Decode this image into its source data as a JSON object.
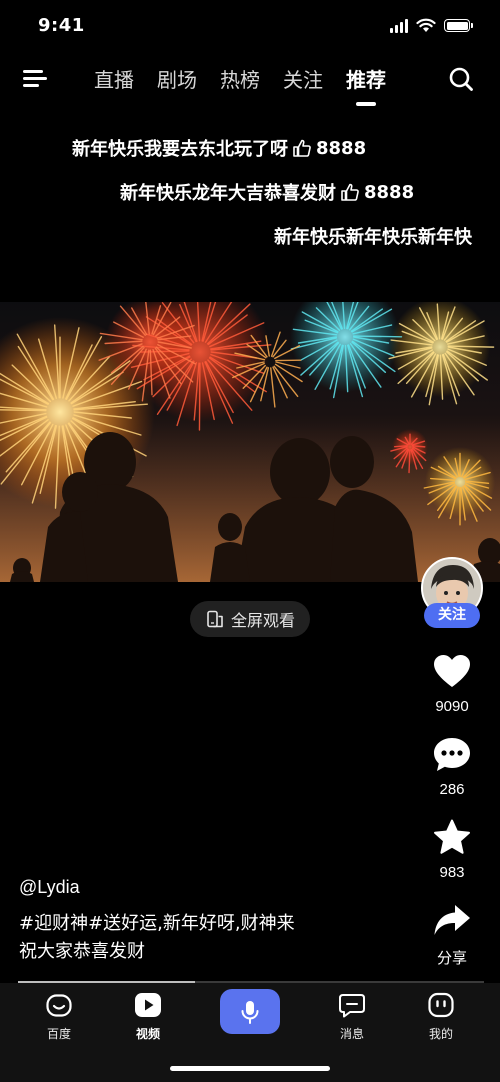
{
  "status_bar": {
    "time": "9:41"
  },
  "top_nav": {
    "tabs": [
      {
        "label": "直播",
        "active": false
      },
      {
        "label": "剧场",
        "active": false
      },
      {
        "label": "热榜",
        "active": false
      },
      {
        "label": "关注",
        "active": false
      },
      {
        "label": "推荐",
        "active": true
      }
    ]
  },
  "danmaku": [
    {
      "text": "新年快乐我要去东北玩了呀",
      "likes": "8888"
    },
    {
      "text": "新年快乐龙年大吉恭喜发财",
      "likes": "8888"
    },
    {
      "text": "新年快乐新年快乐新年快"
    }
  ],
  "video": {
    "fullscreen_label": "全屏观看",
    "progress": 0.38
  },
  "actions": {
    "follow_label": "关注",
    "likes": "9090",
    "comments": "286",
    "favorites": "983",
    "share_label": "分享"
  },
  "post": {
    "author": "@Lydia",
    "caption_line1": "#迎财神#送好运,新年好呀,财神来",
    "caption_line2": "祝大家恭喜发财"
  },
  "bottom_nav": {
    "items": [
      {
        "label": "百度",
        "icon": "baidu-face-icon"
      },
      {
        "label": "视频",
        "icon": "play-icon",
        "active": true
      },
      {
        "label": "",
        "icon": "microphone-icon"
      },
      {
        "label": "消息",
        "icon": "message-icon"
      },
      {
        "label": "我的",
        "icon": "profile-face-icon"
      }
    ]
  },
  "colors": {
    "accent": "#4e6ef2",
    "mic": "#5a73ee",
    "background": "#000000"
  }
}
